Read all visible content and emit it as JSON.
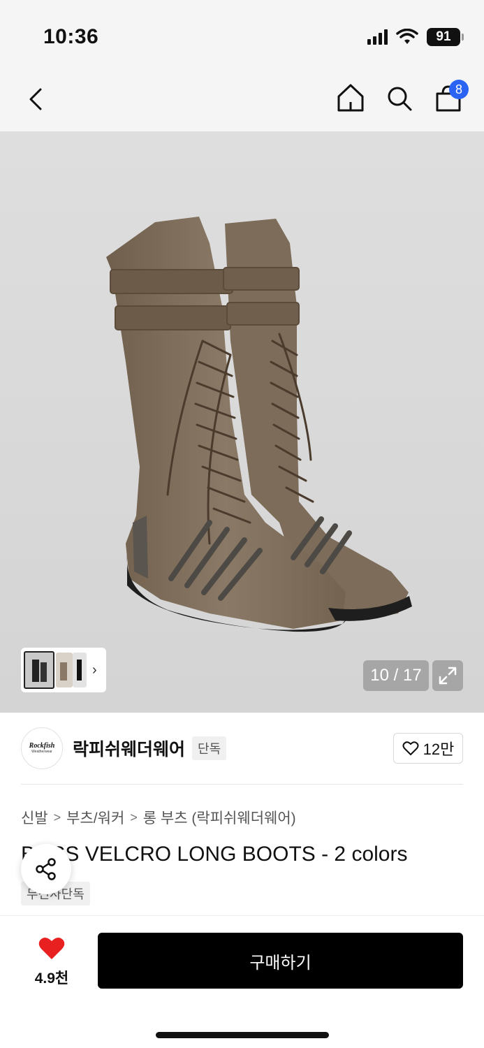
{
  "status_bar": {
    "time": "10:36",
    "battery": "91"
  },
  "nav": {
    "cart_count": "8"
  },
  "gallery": {
    "page_counter": "10 / 17"
  },
  "brand": {
    "logo_text": "Rockfish",
    "logo_subtext": "Weatherwear",
    "name": "락피쉬웨더웨어",
    "exclusive_tag": "단독",
    "like_count": "12만"
  },
  "breadcrumb": [
    "신발",
    "부츠/워커",
    "롱 부츠 (락피쉬웨더웨어)"
  ],
  "product": {
    "title": "BOSS VELCRO LONG BOOTS - 2 colors",
    "badge": "무신사단독"
  },
  "bottom": {
    "wish_count": "4.9천",
    "buy_label": "구매하기"
  },
  "colors": {
    "accent_blue": "#2b63f5",
    "heart_red": "#e82020"
  }
}
